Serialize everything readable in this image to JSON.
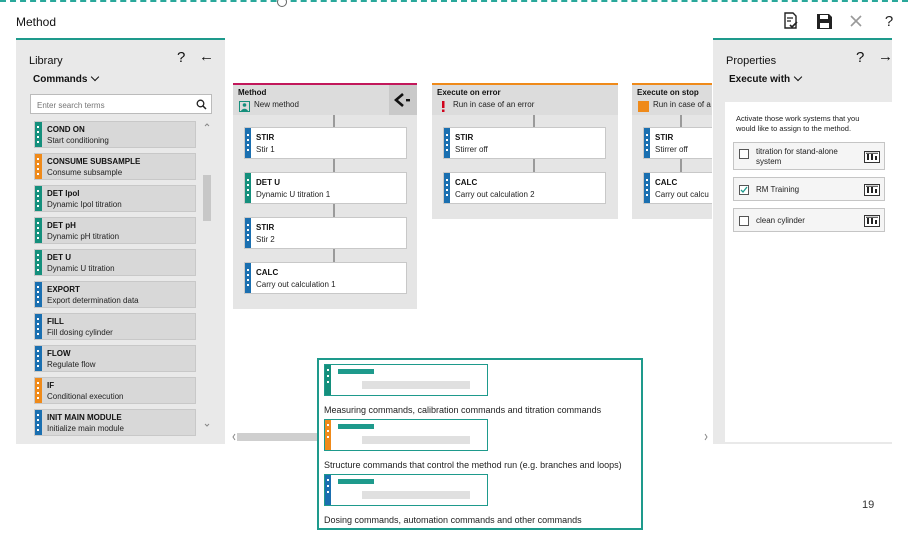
{
  "app": {
    "title": "Method"
  },
  "toolbar": {
    "icons": [
      "check-list-icon",
      "save-icon",
      "close-icon",
      "help-icon"
    ],
    "help": "?"
  },
  "library": {
    "title": "Library",
    "help": "?",
    "dropdown": "Commands",
    "search_placeholder": "Enter search terms",
    "items": [
      {
        "name": "COND ON",
        "desc": "Start conditioning",
        "color": "#148f7c"
      },
      {
        "name": "CONSUME SUBSAMPLE",
        "desc": "Consume subsample",
        "color": "#ef8a1a"
      },
      {
        "name": "DET Ipol",
        "desc": "Dynamic Ipol titration",
        "color": "#148f7c"
      },
      {
        "name": "DET pH",
        "desc": "Dynamic pH titration",
        "color": "#148f7c"
      },
      {
        "name": "DET U",
        "desc": "Dynamic U titration",
        "color": "#148f7c"
      },
      {
        "name": "EXPORT",
        "desc": "Export determination data",
        "color": "#1a6fb0"
      },
      {
        "name": "FILL",
        "desc": "Fill dosing cylinder",
        "color": "#1a6fb0"
      },
      {
        "name": "FLOW",
        "desc": "Regulate flow",
        "color": "#1a6fb0"
      },
      {
        "name": "IF",
        "desc": "Conditional execution",
        "color": "#ef8a1a"
      },
      {
        "name": "INIT MAIN MODULE",
        "desc": "Initialize main module",
        "color": "#1a6fb0"
      }
    ]
  },
  "tracks": [
    {
      "title": "Method",
      "subtitle": "New method",
      "icon": "method-icon",
      "accent": "#c2185b",
      "commands": [
        {
          "name": "STIR",
          "desc": "Stir 1",
          "color": "#1a6fb0"
        },
        {
          "name": "DET U",
          "desc": "Dynamic U titration 1",
          "color": "#148f7c"
        },
        {
          "name": "STIR",
          "desc": "Stir 2",
          "color": "#1a6fb0"
        },
        {
          "name": "CALC",
          "desc": "Carry out calculation 1",
          "color": "#1a6fb0"
        }
      ]
    },
    {
      "title": "Execute on error",
      "subtitle": "Run in case of an error",
      "icon": "error-icon",
      "accent": "#ef8a1a",
      "commands": [
        {
          "name": "STIR",
          "desc": "Stirrer off",
          "color": "#1a6fb0"
        },
        {
          "name": "CALC",
          "desc": "Carry out calculation 2",
          "color": "#1a6fb0"
        }
      ]
    },
    {
      "title": "Execute on stop",
      "subtitle": "Run in case of a",
      "icon": "stop-icon",
      "accent": "#ef8a1a",
      "commands": [
        {
          "name": "STIR",
          "desc": "Stirrer off",
          "color": "#1a6fb0"
        },
        {
          "name": "CALC",
          "desc": "Carry out calcu",
          "color": "#1a6fb0"
        }
      ]
    }
  ],
  "properties": {
    "title": "Properties",
    "help": "?",
    "dropdown": "Execute with",
    "description": "Activate those work systems that you would like to assign to the method.",
    "work_systems": [
      {
        "label": "titration for stand-alone system",
        "checked": false
      },
      {
        "label": "RM Training",
        "checked": true
      },
      {
        "label": "clean cylinder",
        "checked": false
      }
    ]
  },
  "legend": [
    {
      "text": "Measuring commands, calibration commands and titration commands",
      "color": "#148f7c"
    },
    {
      "text": "Structure commands that control the method run (e.g. branches and loops)",
      "color": "#ef8a1a"
    },
    {
      "text": "Dosing commands, automation commands and other commands",
      "color": "#1a6fb0"
    }
  ],
  "page_number": "19"
}
